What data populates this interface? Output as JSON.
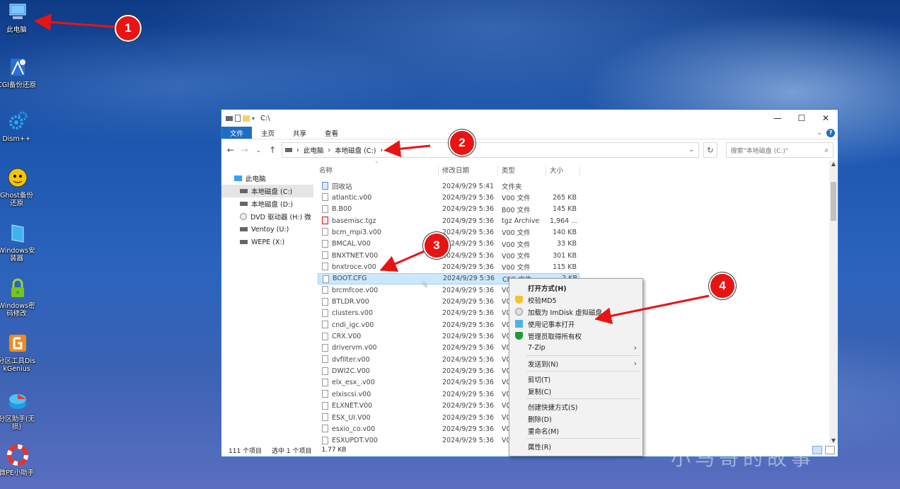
{
  "desktop": {
    "icons": [
      {
        "label": "此电脑",
        "icon": "computer-icon"
      },
      {
        "label": "CGI备份还原",
        "icon": "cgi-backup-icon"
      },
      {
        "label": "Dism++",
        "icon": "dism-gear-icon"
      },
      {
        "label": "Ghost备份还原",
        "icon": "ghost-icon"
      },
      {
        "label": "Windows安装器",
        "icon": "windows-installer-icon"
      },
      {
        "label": "Windows密码修改",
        "icon": "lock-icon"
      },
      {
        "label": "分区工具DiskGenius",
        "icon": "diskgenius-icon"
      },
      {
        "label": "分区助手(无损)",
        "icon": "partition-assistant-icon"
      },
      {
        "label": "微PE小助手",
        "icon": "lifebuoy-icon"
      }
    ]
  },
  "window": {
    "title": "C:\\",
    "tabs": [
      "文件",
      "主页",
      "共享",
      "查看"
    ],
    "address": {
      "parts": [
        "此电脑",
        "本地磁盘 (C:)"
      ]
    },
    "search_placeholder": "搜索\"本地磁盘 (C:)\"",
    "nav_pane": [
      {
        "label": "此电脑",
        "icon": "computer-icon",
        "selected": false,
        "sub": false
      },
      {
        "label": "本地磁盘 (C:)",
        "icon": "drive-icon",
        "selected": true,
        "sub": true
      },
      {
        "label": "本地磁盘 (D:)",
        "icon": "drive-icon",
        "selected": false,
        "sub": true
      },
      {
        "label": "DVD 驱动器 (H:) 微",
        "icon": "dvd-icon",
        "selected": false,
        "sub": true
      },
      {
        "label": "Ventoy (U:)",
        "icon": "drive-icon",
        "selected": false,
        "sub": true
      },
      {
        "label": "WEPE (X:)",
        "icon": "drive-icon",
        "selected": false,
        "sub": true
      }
    ],
    "columns": {
      "name": "名称",
      "date": "修改日期",
      "type": "类型",
      "size": "大小"
    },
    "files": [
      {
        "name": "回收站",
        "date": "2024/9/29 5:41",
        "type": "文件夹",
        "size": "",
        "kind": "folder"
      },
      {
        "name": "atlantic.v00",
        "date": "2024/9/29 5:36",
        "type": "V00 文件",
        "size": "265 KB",
        "kind": "file"
      },
      {
        "name": "B.B00",
        "date": "2024/9/29 5:36",
        "type": "B00 文件",
        "size": "145 KB",
        "kind": "file"
      },
      {
        "name": "basemisc.tgz",
        "date": "2024/9/29 5:36",
        "type": "tgz Archive",
        "size": "1,964 ...",
        "kind": "tgz"
      },
      {
        "name": "bcm_mpi3.v00",
        "date": "2024/9/29 5:36",
        "type": "V00 文件",
        "size": "140 KB",
        "kind": "file"
      },
      {
        "name": "BMCAL.V00",
        "date": "2024/9/29 5:36",
        "type": "V00 文件",
        "size": "33 KB",
        "kind": "file"
      },
      {
        "name": "BNXTNET.V00",
        "date": "2024/9/29 5:36",
        "type": "V00 文件",
        "size": "301 KB",
        "kind": "file"
      },
      {
        "name": "bnxtroce.v00",
        "date": "2024/9/29 5:36",
        "type": "V00 文件",
        "size": "115 KB",
        "kind": "file"
      },
      {
        "name": "BOOT.CFG",
        "date": "2024/9/29 5:36",
        "type": "CFG 文件",
        "size": "2 KB",
        "kind": "file",
        "highlight": true
      },
      {
        "name": "brcmfcoe.v00",
        "date": "2024/9/29 5:36",
        "type": "V0",
        "size": "",
        "kind": "file"
      },
      {
        "name": "BTLDR.V00",
        "date": "2024/9/29 5:36",
        "type": "V0",
        "size": "",
        "kind": "file"
      },
      {
        "name": "clusters.v00",
        "date": "2024/9/29 5:36",
        "type": "V0",
        "size": "",
        "kind": "file"
      },
      {
        "name": "cndi_igc.v00",
        "date": "2024/9/29 5:36",
        "type": "V0",
        "size": "",
        "kind": "file"
      },
      {
        "name": "CRX.V00",
        "date": "2024/9/29 5:36",
        "type": "V0",
        "size": "",
        "kind": "file"
      },
      {
        "name": "drivervm.v00",
        "date": "2024/9/29 5:36",
        "type": "V0",
        "size": "",
        "kind": "file"
      },
      {
        "name": "dvfilter.v00",
        "date": "2024/9/29 5:36",
        "type": "V0",
        "size": "",
        "kind": "file"
      },
      {
        "name": "DWI2C.V00",
        "date": "2024/9/29 5:36",
        "type": "V0",
        "size": "",
        "kind": "file"
      },
      {
        "name": "elx_esx_.v00",
        "date": "2024/9/29 5:36",
        "type": "V0",
        "size": "",
        "kind": "file"
      },
      {
        "name": "elxiscsi.v00",
        "date": "2024/9/29 5:36",
        "type": "V0",
        "size": "",
        "kind": "file"
      },
      {
        "name": "ELXNET.V00",
        "date": "2024/9/29 5:36",
        "type": "V0",
        "size": "",
        "kind": "file"
      },
      {
        "name": "ESX_UI.V00",
        "date": "2024/9/29 5:36",
        "type": "V0",
        "size": "",
        "kind": "file"
      },
      {
        "name": "esxio_co.v00",
        "date": "2024/9/29 5:36",
        "type": "V0",
        "size": "",
        "kind": "file"
      },
      {
        "name": "ESXUPDT.V00",
        "date": "2024/9/29 5:36",
        "type": "V0",
        "size": "",
        "kind": "file"
      }
    ],
    "status": {
      "count": "111 个项目",
      "selected": "选中 1 个项目",
      "size": "1.77 KB"
    }
  },
  "context_menu": {
    "items": [
      {
        "label": "打开方式(H)",
        "bold": true,
        "icon": "",
        "submenu": false
      },
      {
        "label": "校验MD5",
        "icon": "shield-icon",
        "submenu": false
      },
      {
        "label": "加载为 ImDisk 虚拟磁盘",
        "icon": "disk-icon",
        "submenu": false
      },
      {
        "label": "使用记事本打开",
        "icon": "notepad-icon",
        "submenu": false
      },
      {
        "label": "管理员取得所有权",
        "icon": "green-shield-icon",
        "submenu": false
      },
      {
        "label": "7-Zip",
        "icon": "",
        "submenu": true
      },
      {
        "sep": true
      },
      {
        "label": "发送到(N)",
        "icon": "",
        "submenu": true
      },
      {
        "sep": true
      },
      {
        "label": "剪切(T)",
        "icon": "",
        "submenu": false
      },
      {
        "label": "复制(C)",
        "icon": "",
        "submenu": false
      },
      {
        "sep": true
      },
      {
        "label": "创建快捷方式(S)",
        "icon": "",
        "submenu": false
      },
      {
        "label": "删除(D)",
        "icon": "",
        "submenu": false
      },
      {
        "label": "重命名(M)",
        "icon": "",
        "submenu": false
      },
      {
        "sep": true
      },
      {
        "label": "属性(R)",
        "icon": "",
        "submenu": false
      }
    ]
  },
  "callouts": [
    "1",
    "2",
    "3",
    "4"
  ],
  "watermark": "小马哥的故事",
  "colors": {
    "accent": "#1f6ec5",
    "callout": "#e81414",
    "selection": "#cce8ff"
  }
}
